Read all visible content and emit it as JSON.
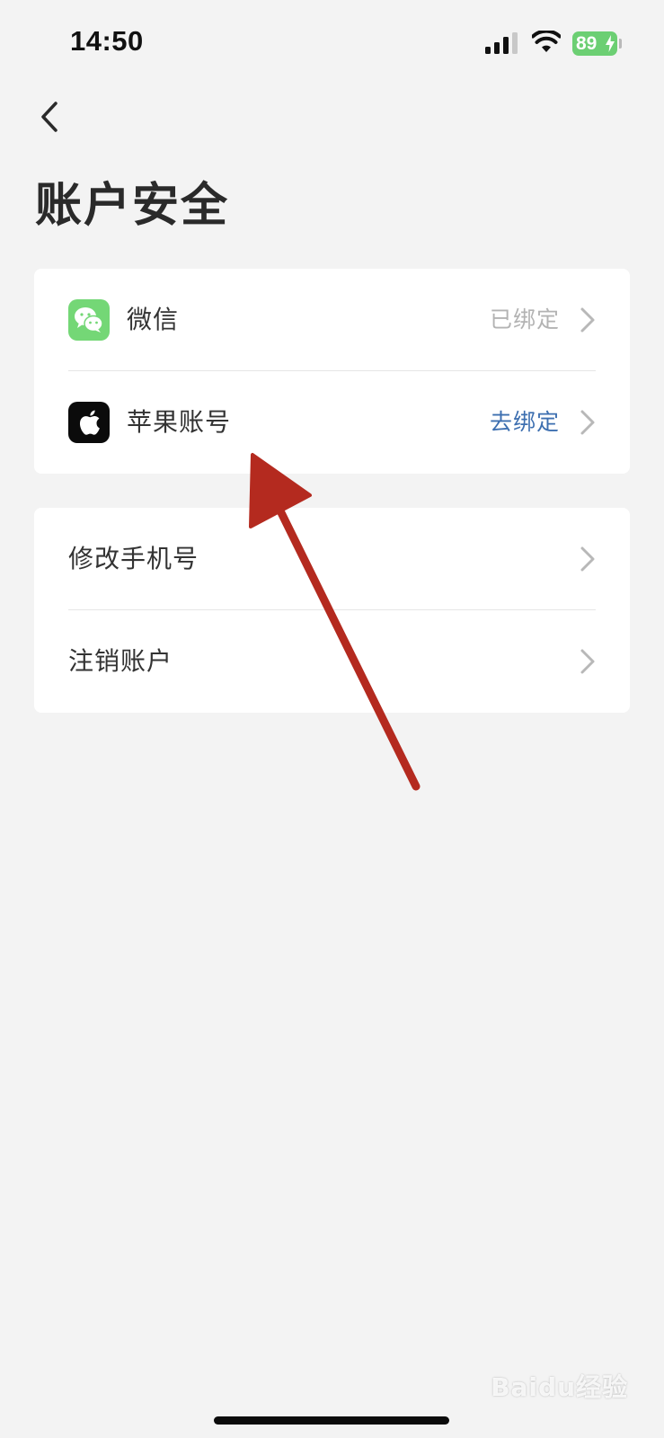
{
  "status_bar": {
    "time": "14:50",
    "battery_level": "89",
    "icons": [
      "signal-icon",
      "wifi-icon",
      "battery-icon",
      "charging-bolt-icon"
    ]
  },
  "header": {
    "back_icon": "chevron-left-icon",
    "title": "账户安全"
  },
  "bindings_card": {
    "items": [
      {
        "label": "微信",
        "status": "已绑定",
        "icon": "wechat-icon",
        "status_color": "#b3b3b3"
      },
      {
        "label": "苹果账号",
        "status": "去绑定",
        "icon": "apple-icon",
        "status_color": "#3d6fb0"
      }
    ]
  },
  "account_card": {
    "items": [
      {
        "label": "修改手机号"
      },
      {
        "label": "注销账户"
      }
    ]
  },
  "annotation": {
    "arrow_color": "#b42a1f"
  },
  "watermark": {
    "text": "Baidu经验"
  },
  "colors": {
    "background": "#f3f3f3",
    "wechat_green": "#74d776",
    "battery_green": "#6ccf73",
    "link_blue": "#3d6fb0"
  }
}
